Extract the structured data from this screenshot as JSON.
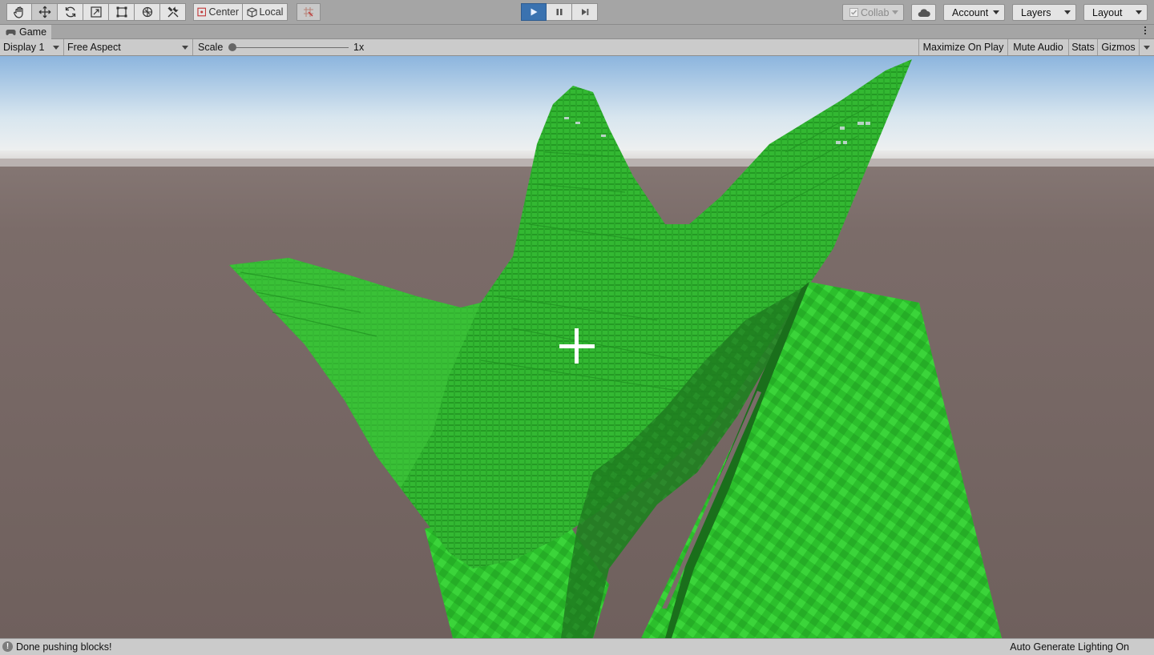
{
  "toolbar": {
    "tools": [
      {
        "name": "hand-tool-icon"
      },
      {
        "name": "move-tool-icon"
      },
      {
        "name": "rotate-tool-icon"
      },
      {
        "name": "scale-tool-icon"
      },
      {
        "name": "rect-tool-icon"
      },
      {
        "name": "transform-tool-icon"
      },
      {
        "name": "custom-tool-icon"
      }
    ],
    "active_tool": "move-tool-icon",
    "pivot_mode_label": "Center",
    "pivot_rotation_label": "Local",
    "play_active": true,
    "collab_label": "Collab",
    "account_label": "Account",
    "layers_label": "Layers",
    "layout_label": "Layout"
  },
  "tab": {
    "title": "Game"
  },
  "game_bar": {
    "display": "Display 1",
    "aspect": "Free Aspect",
    "scale_label": "Scale",
    "scale_value": "1x",
    "maximize_on_play": "Maximize On Play",
    "mute_audio": "Mute Audio",
    "stats": "Stats",
    "gizmos": "Gizmos"
  },
  "status": {
    "message": "Done pushing blocks!",
    "lighting": "Auto Generate Lighting On"
  },
  "colors": {
    "toolbar_bg": "#a5a5a5",
    "play_active": "#3a72b0",
    "sky_top": "#89b3dc",
    "horizon": "#eceeee",
    "ground": "#7c6c69",
    "block_green": "#2fb32f",
    "block_light": "#40d43a",
    "shadow_green": "#1e7a1e"
  }
}
